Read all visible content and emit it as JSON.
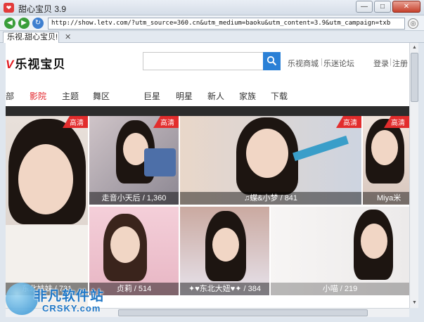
{
  "window": {
    "title": "甜心宝贝 3.9",
    "app_icon_glyph": "❤"
  },
  "addressbar": {
    "url": "http://show.letv.com/?utm_source=360.cn&utm_medium=baoku&utm_content=3.9&utm_campaign=txb"
  },
  "tabs": [
    {
      "label": "乐视.甜心宝贝!"
    }
  ],
  "site": {
    "logo_v": "V",
    "logo_text": "乐视宝贝",
    "links": {
      "mall": "乐视商城",
      "forum": "乐迷论坛",
      "login": "登录",
      "register": "注册"
    },
    "nav": [
      "部",
      "影院",
      "主题",
      "舞区",
      "巨星",
      "明星",
      "新人",
      "家族",
      "下载"
    ],
    "nav_active_index": 1,
    "accent_color": "#e11b22",
    "search_button_color": "#2a80d6"
  },
  "tiles": [
    {
      "badge": "高清",
      "caption": ""
    },
    {
      "badge": "高清",
      "caption": "走音小天后 / 1,360"
    },
    {
      "badge": "高清",
      "caption": "♫蝶&小梦 / 841"
    },
    {
      "badge": "高清",
      "caption": "Miya米"
    },
    {
      "badge": "",
      "caption": "东北妹妹 / 731"
    },
    {
      "badge": "",
      "caption": "贞莉 / 514"
    },
    {
      "badge": "",
      "caption": "✦♥东北大妞♥✦ / 384"
    },
    {
      "badge": "",
      "caption": "小喵 / 219"
    }
  ],
  "watermark": {
    "cn": "非凡软件站",
    "en": "CRSKY.com"
  }
}
